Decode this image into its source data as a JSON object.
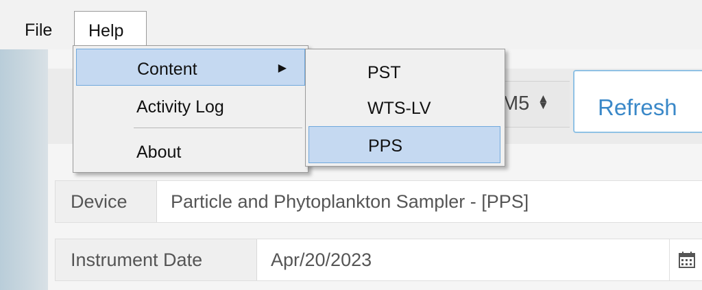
{
  "menubar": {
    "file_label": "File",
    "help_label": "Help"
  },
  "help_menu": {
    "items": [
      {
        "label": "Content",
        "has_submenu": true,
        "highlighted": true
      },
      {
        "label": "Activity Log",
        "highlighted": false
      },
      {
        "label": "About",
        "highlighted": false
      }
    ]
  },
  "content_submenu": {
    "items": [
      {
        "label": "PST",
        "highlighted": false
      },
      {
        "label": "WTS-LV",
        "highlighted": false
      },
      {
        "label": "PPS",
        "highlighted": true
      }
    ]
  },
  "toolbar": {
    "stepper_value": "M5",
    "refresh_label": "Refresh"
  },
  "form": {
    "device_label": "Device",
    "device_value": "Particle and Phytoplankton Sampler - [PPS]",
    "date_label": "Instrument Date",
    "date_value": "Apr/20/2023"
  },
  "colors": {
    "highlight": "#c5d9f1",
    "highlight_border": "#6fa8dc",
    "refresh_text": "#3a88c8",
    "refresh_border": "#8fc1e4"
  },
  "icons": {
    "submenu_arrow": "triangle-right-icon",
    "stepper": "up-down-arrows-icon",
    "calendar": "calendar-icon"
  }
}
